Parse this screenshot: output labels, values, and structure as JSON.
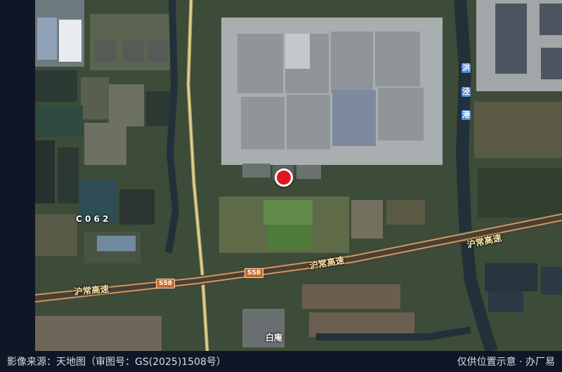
{
  "map": {
    "labels": {
      "road_c062": "C 0 6 2",
      "expressway_1": "沪常高速",
      "expressway_2": "沪常高速",
      "expressway_3": "沪常高速",
      "shield_1": "S58",
      "shield_2": "S58",
      "place": "白庵",
      "river_chars": [
        "洪",
        "泾",
        "港"
      ]
    },
    "marker": {
      "color": "#e0171e"
    }
  },
  "footer": {
    "source": "影像来源：天地图（审图号：GS(2025)1508号）",
    "disclaimer": "仅供位置示意 · 办厂易"
  }
}
